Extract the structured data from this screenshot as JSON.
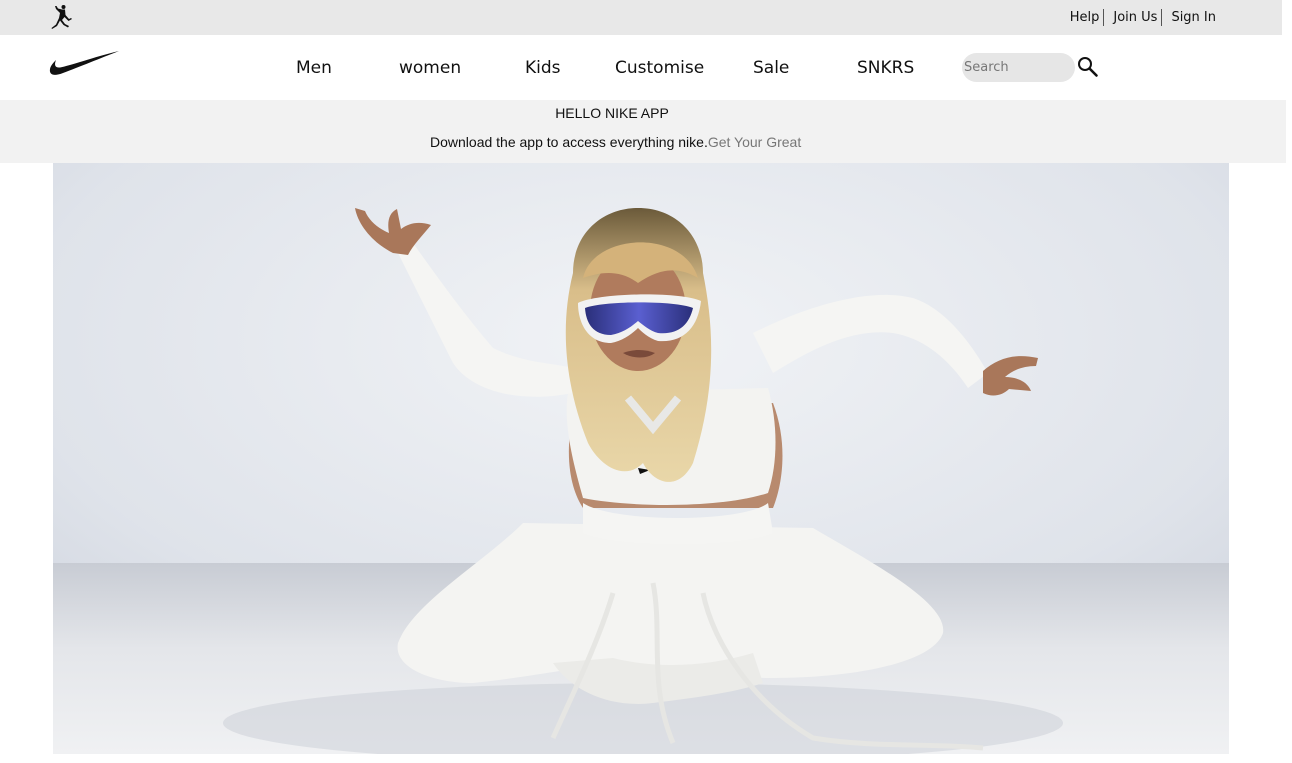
{
  "utility_bar": {
    "logo": "jordan-jumpman-icon",
    "links": [
      "Help",
      "Join Us",
      "Sign In"
    ]
  },
  "nav": {
    "logo": "nike-swoosh-icon",
    "items": [
      "Men",
      "women",
      "Kids",
      "Customise",
      "Sale",
      "SNKRS"
    ],
    "search": {
      "placeholder": "Search",
      "value": ""
    },
    "search_icon": "magnifier-icon"
  },
  "promo": {
    "title": "HELLO NIKE APP",
    "text": "Download the app to access everything nike.",
    "link": "Get Your Great"
  },
  "hero": {
    "description_icon": "hero-photo",
    "background_color": "#dfe3ea"
  }
}
